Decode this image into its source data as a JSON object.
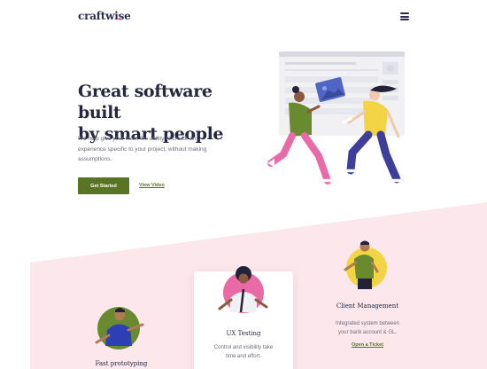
{
  "header": {
    "logo": "craftwise",
    "menu_icon": "hamburger-menu-icon"
  },
  "hero": {
    "title_line1": "Great software built",
    "title_line2": "by smart people",
    "description": "We help give your team the ability to create an experience specific to your project, without making assumptions.",
    "primary_button": "Get Started",
    "secondary_link": "View Video",
    "illustration_icon": "team-collaboration-illustration"
  },
  "features": [
    {
      "title": "Fast prototyping",
      "icon": "person-avatar-icon"
    },
    {
      "title": "UX Testing",
      "description_line1": "Control and visibility take",
      "description_line2": "time and effort.",
      "icon": "person-avatar-icon"
    },
    {
      "title": "Client Management",
      "description_line1": "Integrated system between",
      "description_line2": "your bank account & GL.",
      "link": "Open a Ticket",
      "icon": "person-avatar-icon"
    }
  ],
  "colors": {
    "accent": "#5a7425",
    "navy": "#2b2d52",
    "pink_band": "#fbe7ec",
    "brand_dot": "#e46a8d"
  }
}
